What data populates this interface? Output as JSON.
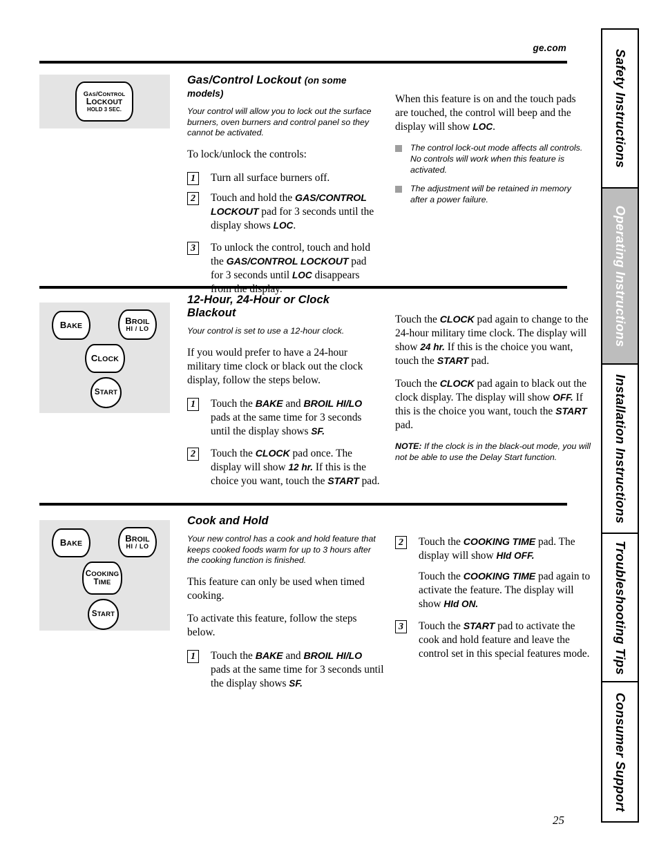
{
  "header": {
    "site": "ge.com",
    "page_number": "25"
  },
  "sidebar": {
    "tabs": [
      {
        "label": "Safety Instructions",
        "active": false
      },
      {
        "label": "Operating Instructions",
        "active": true
      },
      {
        "label": "Installation Instructions",
        "active": false
      },
      {
        "label": "Troubleshooting Tips",
        "active": false
      },
      {
        "label": "Consumer Support",
        "active": false
      }
    ]
  },
  "sections": [
    {
      "id": "gas-control-lockout",
      "heading": "Gas/Control Lockout",
      "heading_sub": "(on some models)",
      "diagram": {
        "pads": [
          {
            "name": "gas-control-lockout-pad",
            "line1": "Gas/Control",
            "line2": "Lockout",
            "line3": "HOLD 3 SEC."
          }
        ]
      },
      "left_column": {
        "intro": "Your control will allow you to lock out the surface burners, oven burners and control panel so they cannot be activated.",
        "lead": "To lock/unlock the controls:",
        "steps": [
          {
            "number": "1",
            "text": "Turn all surface burners off."
          },
          {
            "number": "2",
            "text": "Touch and hold the GAS/CONTROL LOCKOUT pad for 3 seconds until the display shows LOC."
          },
          {
            "number": "3",
            "text": "To unlock the control, touch and hold the GAS/CONTROL LOCKOUT pad for 3 seconds until LOC disappears from the display."
          }
        ]
      },
      "right_column": {
        "paragraph": "When this feature is on and the touch pads are touched, the control will beep and the display will show LOC.",
        "bullets": [
          "The control lock-out mode affects all controls. No controls will work when this feature is activated.",
          "The adjustment will be retained in memory after a power failure."
        ]
      }
    },
    {
      "id": "clock-blackout",
      "heading": "12-Hour, 24-Hour or Clock Blackout",
      "heading_sub": "",
      "diagram": {
        "pads": [
          {
            "name": "bake-pad",
            "line1": "Bake",
            "line2": ""
          },
          {
            "name": "broil-hi-lo-pad",
            "line1": "Broil",
            "line2": "HI / LO"
          },
          {
            "name": "clock-pad",
            "line1": "Clock",
            "line2": ""
          },
          {
            "name": "start-pad",
            "line1": "Start",
            "line2": ""
          }
        ]
      },
      "left_column": {
        "intro": "Your control is set to use a 12-hour clock.",
        "lead": "If you would prefer to have a 24-hour military time clock or black out the clock display, follow the steps below.",
        "steps": [
          {
            "number": "1",
            "text": "Touch the BAKE and BROIL HI/LO pads at the same time for 3 seconds until the display shows SF."
          },
          {
            "number": "2",
            "text": "Touch the CLOCK pad once. The display will show 12 hr. If this is the choice you want, touch the START pad."
          }
        ]
      },
      "right_column": {
        "paragraphs": [
          "Touch the CLOCK pad again to change to the 24-hour military time clock. The display will show 24 hr. If this is the choice you want, touch the START pad.",
          "Touch the CLOCK pad again to black out the clock display. The display will show OFF. If this is the choice you want, touch the START pad."
        ],
        "note_label": "NOTE:",
        "note_text": "If the clock is in the black-out mode, you will not be able to use the Delay Start function."
      }
    },
    {
      "id": "cook-and-hold",
      "heading": "Cook and Hold",
      "heading_sub": "",
      "diagram": {
        "pads": [
          {
            "name": "bake-pad",
            "line1": "Bake",
            "line2": ""
          },
          {
            "name": "broil-hi-lo-pad",
            "line1": "Broil",
            "line2": "HI / LO"
          },
          {
            "name": "cooking-time-pad",
            "line1": "Cooking",
            "line2": "Time"
          },
          {
            "name": "start-pad",
            "line1": "Start",
            "line2": ""
          }
        ]
      },
      "left_column": {
        "intro": "Your new control has a cook and hold feature that keeps cooked foods warm for up to 3 hours after the cooking function is finished.",
        "para1": "This feature can only be used when timed cooking.",
        "para2": "To activate this feature, follow the steps below.",
        "steps": [
          {
            "number": "1",
            "text": "Touch the BAKE and BROIL HI/LO pads at the same time for 3 seconds until the display shows SF."
          }
        ]
      },
      "right_column": {
        "steps": [
          {
            "number": "2",
            "text": "Touch the COOKING TIME pad. The display will show HId OFF.",
            "continuation": "Touch the COOKING TIME pad again to activate the feature. The display will show HId ON."
          },
          {
            "number": "3",
            "text": "Touch the START pad to activate the cook and hold feature and leave the control set in this special features mode."
          }
        ]
      }
    }
  ]
}
